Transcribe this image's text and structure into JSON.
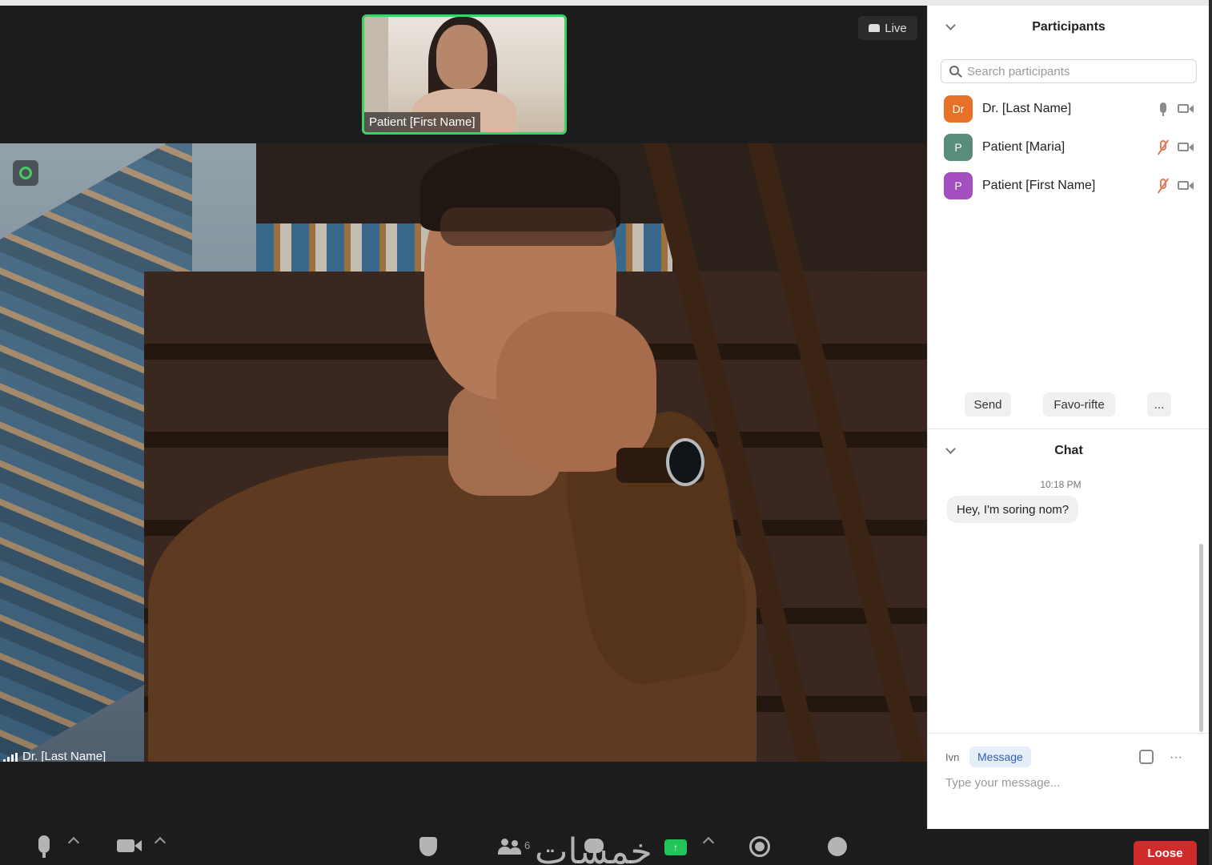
{
  "stage": {
    "thumbnail_label": "Patient [First Name]",
    "live_label": "Live",
    "main_label": "Dr. [Last Name]"
  },
  "toolbar": {
    "participants_count": "6",
    "leave_label": "Loose",
    "watermark": "خمسات"
  },
  "participants": {
    "title": "Participants",
    "search_placeholder": "Search participants",
    "items": [
      {
        "initials": "Dr",
        "name": "Dr. [Last Name]",
        "avatar_color": "#e8712a",
        "muted": false
      },
      {
        "initials": "P",
        "name": "Patient [Maria]",
        "avatar_color": "#5a8c7a",
        "muted": true
      },
      {
        "initials": "P",
        "name": "Patient [First Name]",
        "avatar_color": "#a44fc0",
        "muted": true
      }
    ],
    "buttons": {
      "send": "Send",
      "favorite": "Favo-rifte",
      "more": "..."
    }
  },
  "chat": {
    "title": "Chat",
    "messages": [
      {
        "time": "10:18 PM",
        "text": "Hey, I'm soring nom?"
      }
    ],
    "to_label": "Ivn",
    "to_chip": "Message",
    "compose_placeholder": "Type your message...",
    "more": "···"
  },
  "colors": {
    "accent_green": "#3fcf62",
    "leave_red": "#d02a2a",
    "chip_blue": "#2d5fb8"
  }
}
